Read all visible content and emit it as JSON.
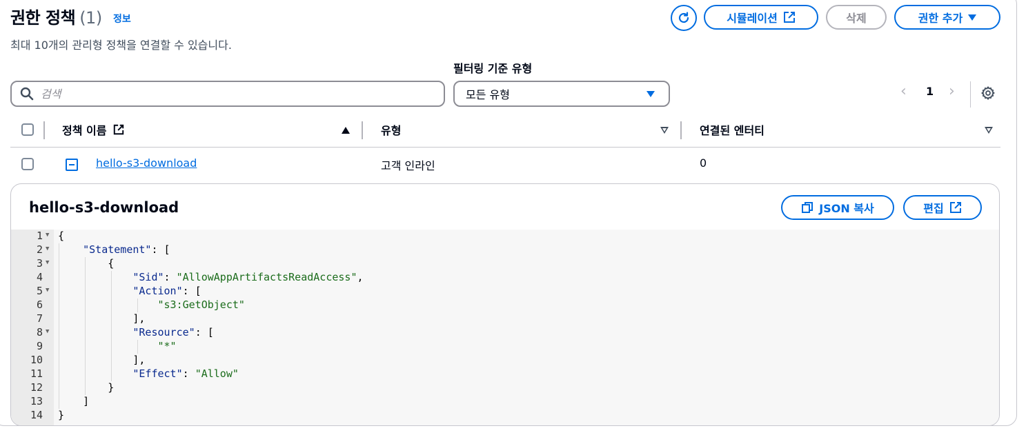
{
  "header": {
    "title": "권한 정책",
    "count": "(1)",
    "info_link": "정보",
    "subtitle": "최대 10개의 관리형 정책을 연결할 수 있습니다."
  },
  "actions": {
    "simulator": "시뮬레이션",
    "delete": "삭제",
    "add_permission": "권한 추가"
  },
  "filter": {
    "search_placeholder": "검색",
    "type_label": "필터링 기준 유형",
    "type_value": "모든 유형"
  },
  "pagination": {
    "page": "1"
  },
  "table": {
    "columns": [
      "정책 이름",
      "유형",
      "연결된 엔터티"
    ],
    "rows": [
      {
        "name": "hello-s3-download",
        "type": "고객 인라인",
        "attached": "0"
      }
    ]
  },
  "detail": {
    "title": "hello-s3-download",
    "copy_json": "JSON 복사",
    "edit": "편집",
    "line_numbers": [
      "1",
      "2",
      "3",
      "4",
      "5",
      "6",
      "7",
      "8",
      "9",
      "10",
      "11",
      "12",
      "13",
      "14"
    ],
    "code": {
      "l1": "{",
      "k_statement": "\"Statement\"",
      "l2_rest": ": [",
      "l3": "{",
      "k_sid": "\"Sid\"",
      "v_sid": "\"AllowAppArtifactsReadAccess\"",
      "k_action": "\"Action\"",
      "v_action": "\"s3:GetObject\"",
      "l7": "],",
      "k_resource": "\"Resource\"",
      "v_resource": "\"*\"",
      "l10": "],",
      "k_effect": "\"Effect\"",
      "v_effect": "\"Allow\"",
      "l12": "}",
      "l13": "]",
      "l14": "}",
      "sep_colon": ": ",
      "sep_comma": ",",
      "open_bracket": ": ["
    }
  },
  "colors": {
    "accent": "#006ce0",
    "text": "#000716",
    "border": "#8c8c94"
  }
}
